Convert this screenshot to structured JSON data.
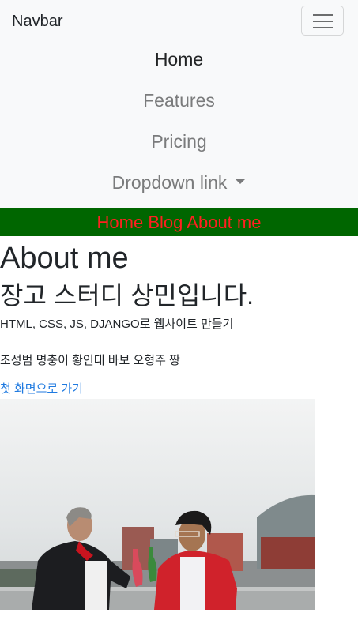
{
  "navbar": {
    "brand": "Navbar",
    "toggler_icon": "hamburger-menu-icon",
    "items": [
      {
        "label": "Home",
        "active": true
      },
      {
        "label": "Features",
        "active": false
      },
      {
        "label": "Pricing",
        "active": false
      },
      {
        "label": "Dropdown link",
        "active": false,
        "icon": "caret-down-icon"
      }
    ]
  },
  "subnav": {
    "background": "#006600",
    "color": "#ff2020",
    "links": [
      "Home",
      "Blog",
      "About me"
    ]
  },
  "main": {
    "title": "About me",
    "subtitle": "장고 스터디 상민입니다.",
    "paragraph1": "HTML, CSS, JS, DJANGO로 웹사이트 만들기",
    "paragraph2": "조성범 명충이 황인태 바보 오형주 짱",
    "back_link": "첫 화면으로 가기"
  }
}
